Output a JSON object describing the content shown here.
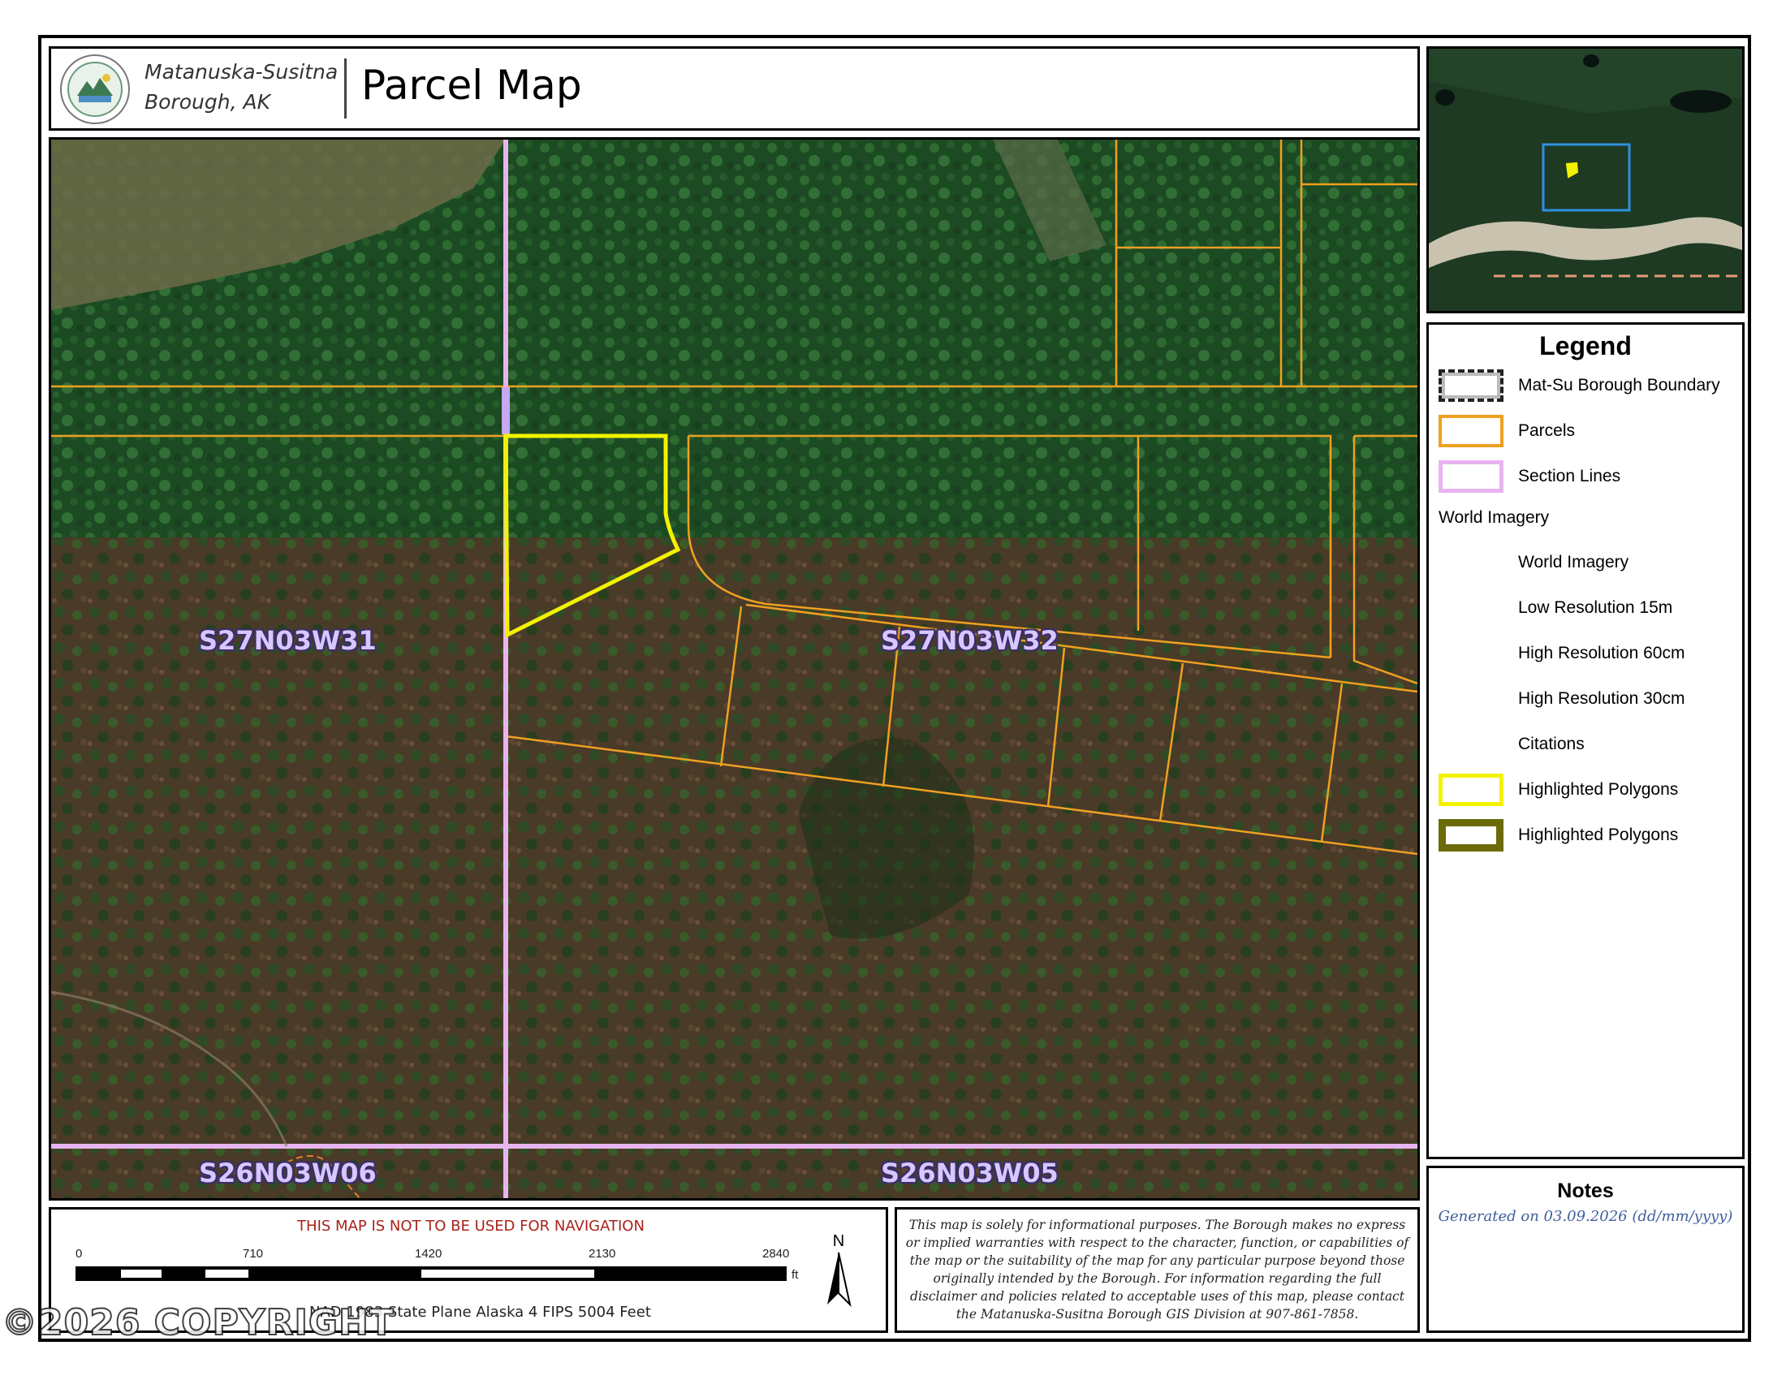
{
  "header": {
    "org_line1": "Matanuska-Susitna",
    "org_line2": "Borough, AK",
    "title": "Parcel Map"
  },
  "map": {
    "section_labels": [
      "S27N03W31",
      "S27N03W32",
      "S26N03W06",
      "S26N03W05"
    ]
  },
  "legend": {
    "title": "Legend",
    "items": [
      {
        "label": "Mat-Su Borough Boundary",
        "swatch": "boundary"
      },
      {
        "label": "Parcels",
        "swatch": "parcels"
      },
      {
        "label": "Section Lines",
        "swatch": "section"
      },
      {
        "label": "World Imagery",
        "swatch": "none"
      },
      {
        "label": "World Imagery",
        "swatch": "none"
      },
      {
        "label": "Low Resolution 15m",
        "swatch": "none"
      },
      {
        "label": "High Resolution 60cm",
        "swatch": "none"
      },
      {
        "label": "High Resolution 30cm",
        "swatch": "none"
      },
      {
        "label": "Citations",
        "swatch": "none"
      },
      {
        "label": "Highlighted Polygons",
        "swatch": "yellow"
      },
      {
        "label": "Highlighted Polygons",
        "swatch": "olive"
      }
    ]
  },
  "notes": {
    "title": "Notes",
    "generated_prefix": "Generated on",
    "generated_date": "03.09.2026",
    "date_format": "(dd/mm/yyyy)"
  },
  "scale": {
    "warning": "THIS MAP IS NOT TO BE USED FOR NAVIGATION",
    "ticks": [
      "0",
      "710",
      "1420",
      "2130",
      "2840"
    ],
    "unit": "ft",
    "north": "N",
    "projection": "NAD 1983 State Plane Alaska 4 FIPS 5004 Feet"
  },
  "disclaimer": "This map is solely for informational purposes. The Borough makes no express or implied warranties with respect to the character, function, or capabilities of the map or the suitability of the map for any particular purpose beyond those originally intended by the Borough. For information regarding the full disclaimer and policies related to acceptable uses of this map, please contact the Matanuska-Susitna Borough GIS Division at 907-861-7858.",
  "watermark": "©2026 COPYRIGHT",
  "colors": {
    "parcel": "#f0a020",
    "section": "#e8b4f0",
    "highlight": "#f2f200",
    "inset_box": "#2f8fe0"
  }
}
